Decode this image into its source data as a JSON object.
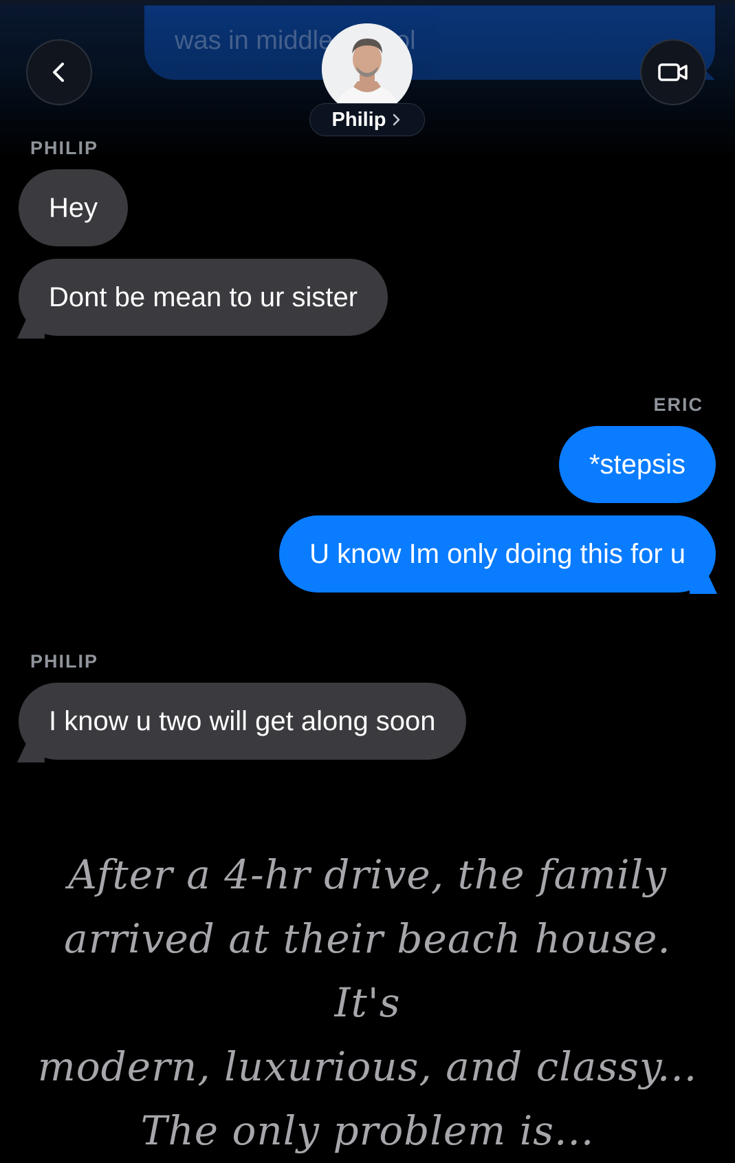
{
  "header": {
    "previous_message": "was in middle school",
    "contact_name": "Philip",
    "back_icon": "chevron-left-icon",
    "video_icon": "video-camera-icon",
    "pill_icon": "chevron-right-icon"
  },
  "messages": [
    {
      "sender": "PHILIP",
      "texts": [
        "Hey",
        "Dont be mean to ur sister"
      ]
    },
    {
      "sender": "ERIC",
      "texts": [
        "*stepsis",
        "U know Im only doing this for u"
      ]
    },
    {
      "sender": "PHILIP",
      "texts": [
        "I know u two will get along soon"
      ]
    }
  ],
  "narration": [
    "After a 4-hr drive, the family",
    "arrived at their beach house. It's",
    "modern, luxurious, and classy...",
    "The only problem is..."
  ],
  "colors": {
    "incoming": "#3a3a3f",
    "outgoing": "#0a7cff",
    "background": "#000000"
  }
}
